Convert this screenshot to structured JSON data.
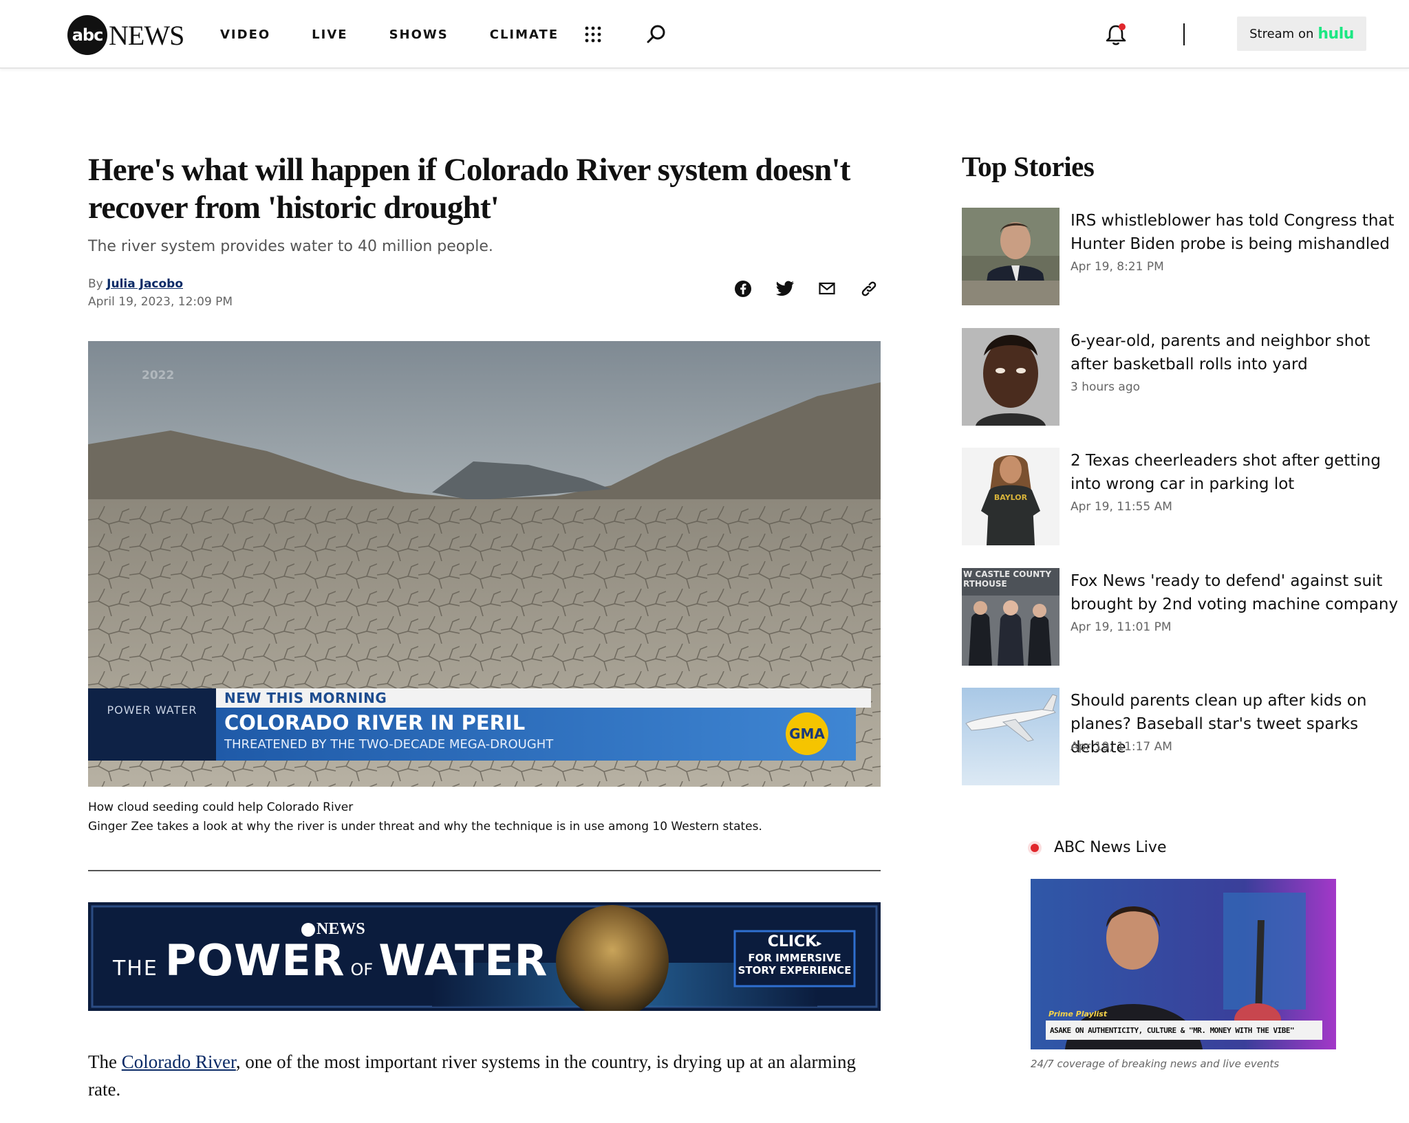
{
  "header": {
    "logo_circle": "abc",
    "logo_news": "NEWS",
    "nav": [
      "VIDEO",
      "LIVE",
      "SHOWS",
      "CLIMATE"
    ],
    "stream_label": "Stream on",
    "stream_brand": "hulu"
  },
  "article": {
    "headline": "Here's what will happen if Colorado River system doesn't recover from 'historic drought'",
    "dek": "The river system provides water to 40 million people.",
    "by_prefix": "By",
    "author": "Julia Jacobo",
    "date": "April 19, 2023, 12:09 PM",
    "hero": {
      "year_watermark": "2022",
      "lower_third_kicker": "NEW THIS MORNING",
      "lower_third_title": "COLORADO RIVER IN PERIL",
      "lower_third_sub": "THREATENED BY THE TWO-DECADE MEGA-DROUGHT",
      "badge": "GMA",
      "box_label": "POWER WATER"
    },
    "caption_title": "How cloud seeding could help Colorado River",
    "caption_desc": "Ginger Zee takes a look at why the river is under threat and why the technique is in use among 10 Western states.",
    "banner": {
      "brand": "NEWS",
      "title_the": "THE",
      "title_power": "POWER",
      "title_of": "OF",
      "title_water": "WATER",
      "cta_click": "CLICK",
      "cta_line1": "FOR IMMERSIVE",
      "cta_line2": "STORY EXPERIENCE"
    },
    "body_pre": "The ",
    "body_link": "Colorado River",
    "body_post": ", one of the most important river systems in the country, is drying up at an alarming rate."
  },
  "sidebar": {
    "title": "Top Stories",
    "stories": [
      {
        "title": "IRS whistleblower has told Congress that Hunter Biden probe is being mishandled",
        "time": "Apr 19, 8:21 PM"
      },
      {
        "title": "6-year-old, parents and neighbor shot after basketball rolls into yard",
        "time": "3 hours ago"
      },
      {
        "title": "2 Texas cheerleaders shot after getting into wrong car in parking lot",
        "time": "Apr 19, 11:55 AM",
        "thumb_text": "BAYLOR"
      },
      {
        "title": "Fox News 'ready to defend' against suit brought by 2nd voting machine company",
        "time": "Apr 19, 11:01 PM",
        "thumb_text": "W CASTLE COUNTY RTHOUSE"
      },
      {
        "title": "Should parents clean up after kids on planes? Baseball star's tweet sparks debate",
        "time": "Apr 19, 11:17 AM"
      }
    ],
    "live": {
      "label": "ABC News Live",
      "chyron_kicker": "Prime Playlist",
      "chyron": "ASAKE ON AUTHENTICITY, CULTURE & \"MR. MONEY WITH THE VIBE\"",
      "caption": "24/7 coverage of breaking news and live events"
    }
  }
}
